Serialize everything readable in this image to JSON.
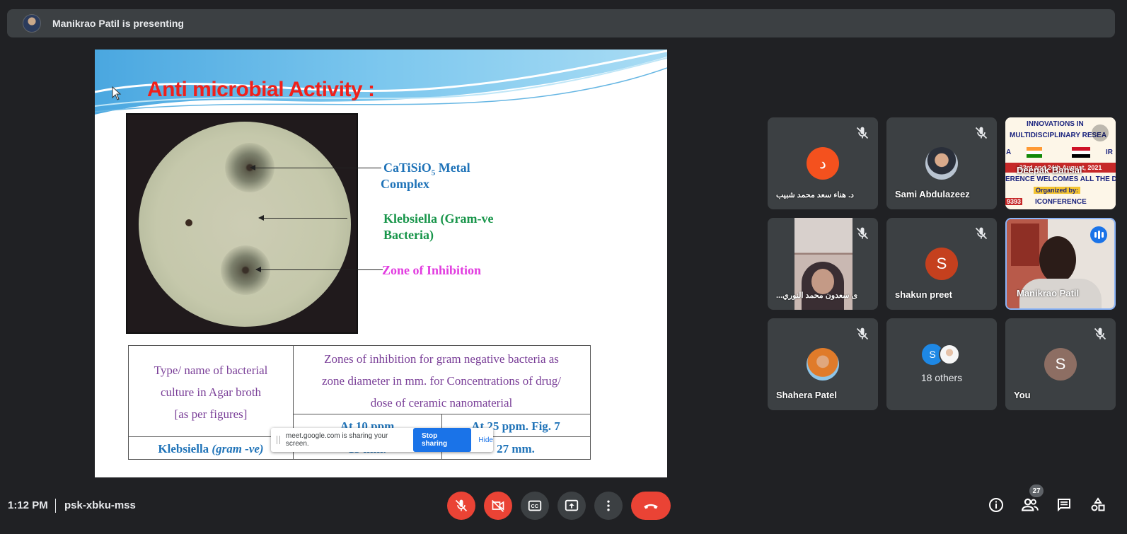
{
  "topbar": {
    "presenting_text": "Manikrao Patil is presenting"
  },
  "slide": {
    "title": "Anti microbial Activity :",
    "labels": {
      "metal_main": "CaTiSiO",
      "metal_sub": "5",
      "metal_rest": " Metal",
      "metal_line2": "Complex",
      "bacteria_line1": "Klebsiella (Gram-ve",
      "bacteria_line2": "Bacteria)",
      "zone": "Zone of Inhibition"
    },
    "table": {
      "col1_header": [
        "Type/ name of bacterial",
        "culture in Agar broth",
        "[as per figures]"
      ],
      "col2_header": [
        "Zones of inhibition  for gram negative bacteria as",
        "zone diameter in mm. for Concentrations of drug/",
        "dose of ceramic nanomaterial"
      ],
      "sub1": "At 10 ppm",
      "sub2": "At 25  ppm. Fig. 7",
      "row_name": "Klebsiella",
      "row_name_suffix": "(gram -ve)",
      "row_val1": "15 mm.",
      "row_val2": "27 mm."
    }
  },
  "share_popup": {
    "text": "meet.google.com is sharing your screen.",
    "stop": "Stop sharing",
    "hide": "Hide"
  },
  "participants": [
    {
      "name": "د. هناء سعد محمد شبيب",
      "avatar_letter": "د",
      "avatar_color": "#f4511e",
      "muted": true
    },
    {
      "name": "Sami Abdulazeez",
      "muted": true
    },
    {
      "name": "Deepak Bansal",
      "muted": false,
      "banner": {
        "line1": "INNOVATIONS IN",
        "line2": "MULTIDISCIPLINARY RESEA",
        "date": "23rd and 24th August, 2021",
        "welcome": "ERENCE WELCOMES ALL THE DELE",
        "org": "Organized by:",
        "brand": "ICONFERENCE",
        "num": "9393",
        "left_letter": "A",
        "right_letter": "IR"
      }
    },
    {
      "name": "...ى سعدون محمد النوري",
      "muted": true
    },
    {
      "name": "shakun preet",
      "avatar_letter": "S",
      "avatar_color": "#c5401e",
      "muted": true
    },
    {
      "name": "Manikrao Patil",
      "muted": false,
      "speaking": true
    },
    {
      "name": "Shahera Patel",
      "muted": true
    },
    {
      "name": "18 others",
      "avatar_letter": "S",
      "avatar_color": "#1e88e5"
    },
    {
      "name": "You",
      "avatar_letter": "S",
      "avatar_color": "#8d6e63",
      "muted": true
    }
  ],
  "bottom": {
    "time": "1:12 PM",
    "meeting_code": "psk-xbku-mss",
    "participants_count": "27",
    "accent_red": "#ea4335",
    "accent_blue": "#1a73e8"
  }
}
